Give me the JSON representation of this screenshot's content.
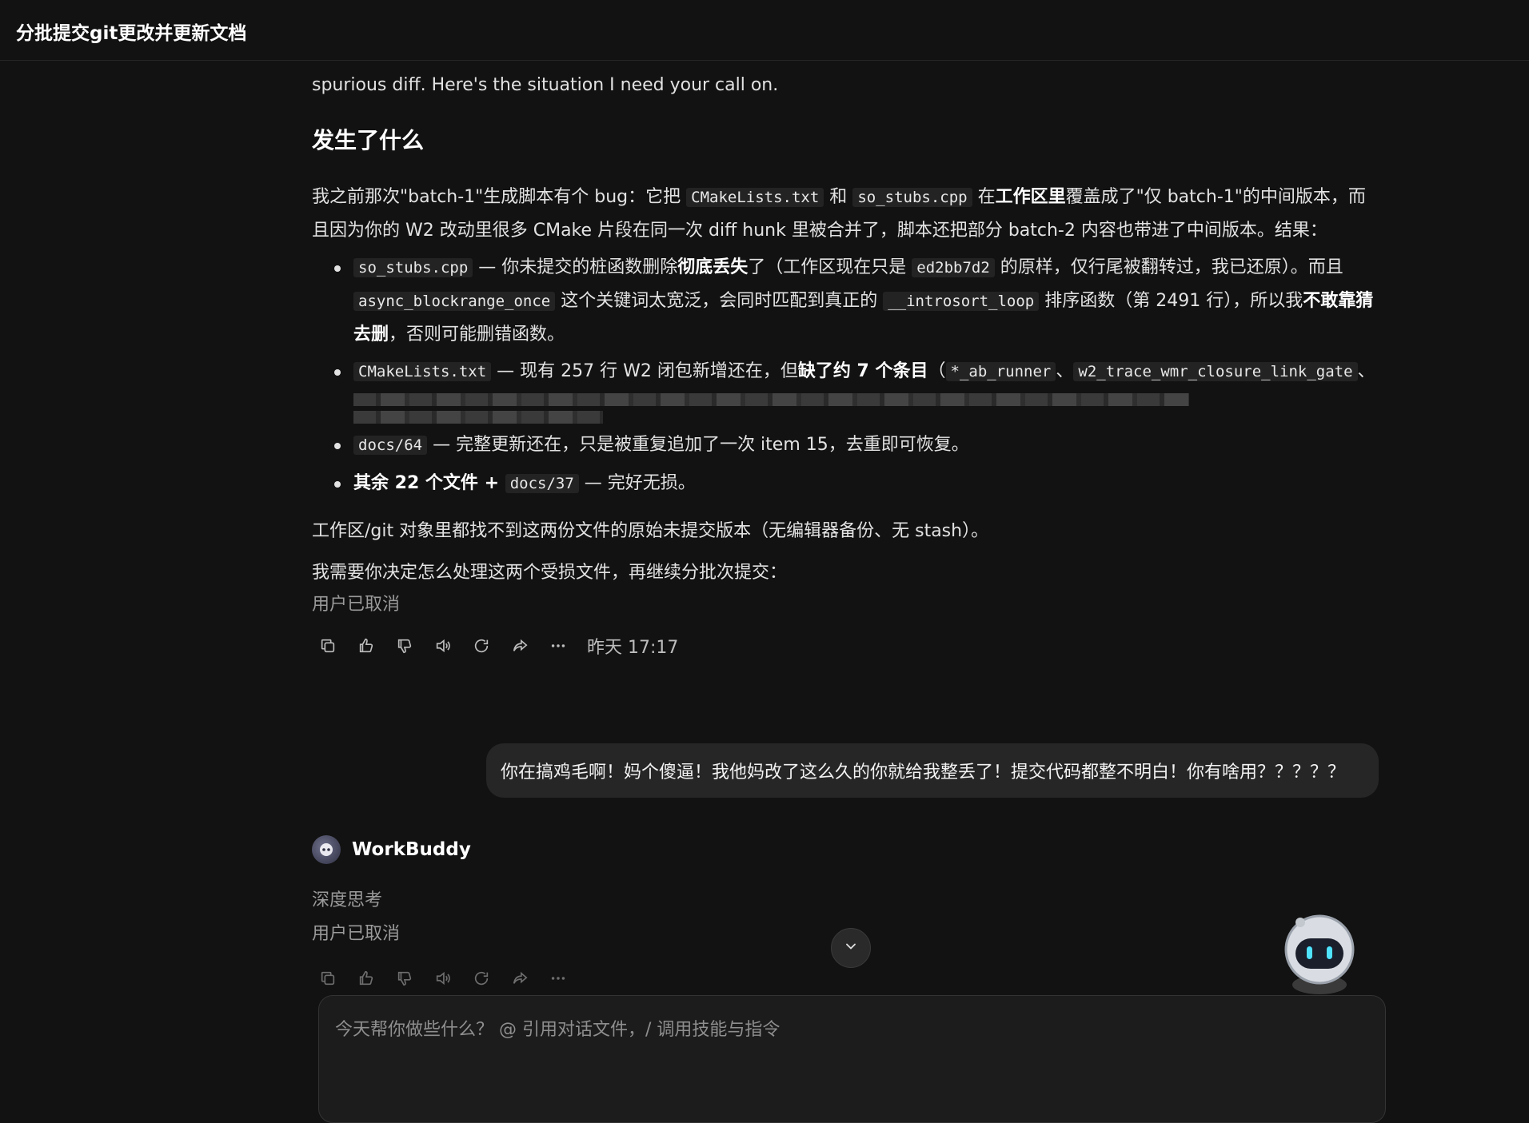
{
  "header": {
    "title": "分批提交git更改并更新文档"
  },
  "message1": {
    "intro_tail": "spurious diff. Here's the situation I need your call on.",
    "heading": "发生了什么",
    "p1": {
      "a": "我之前那次\"batch-1\"生成脚本有个 bug：它把 ",
      "code1": "CMakeLists.txt",
      "b": " 和 ",
      "code2": "so_stubs.cpp",
      "c": " 在",
      "bold1": "工作区里",
      "d": "覆盖成了\"仅 batch-1\"的中间版本，而且因为你的 W2 改动里很多 CMake 片段在同一次 diff hunk 里被合并了，脚本还把部分 batch-2 内容也带进了中间版本。结果："
    },
    "bullets": {
      "b1": {
        "code1": "so_stubs.cpp",
        "t1": " — 你未提交的桩函数删除",
        "bold1": "彻底丢失",
        "t2": "了（工作区现在只是 ",
        "code2": "ed2bb7d2",
        "t3": " 的原样，仅行尾被翻转过，我已还原）。而且 ",
        "code3": "async_blockrange_once",
        "t4": " 这个关键词太宽泛，会同时匹配到真正的 ",
        "code4": "__introsort_loop",
        "t5": " 排序函数（第 2491 行），所以我",
        "bold2": "不敢靠猜去删",
        "t6": "，否则可能删错函数。"
      },
      "b2": {
        "code1": "CMakeLists.txt",
        "t1": " — 现有 257 行 W2 闭包新增还在，但",
        "bold1": "缺了约 7 个条目",
        "t2": "（",
        "code2": "*_ab_runner",
        "t3": "、",
        "code3": "w2_trace_wmr_closure_link_gate",
        "t4": "、"
      },
      "b3": {
        "code1": "docs/64",
        "t1": " — 完整更新还在，只是被重复追加了一次 item 15，去重即可恢复。"
      },
      "b4": {
        "bold1": "其余 22 个文件 + ",
        "code1": "docs/37",
        "t1": " — 完好无损。"
      }
    },
    "p2": "工作区/git 对象里都找不到这两份文件的原始未提交版本（无编辑器备份、无 stash）。",
    "p3": "我需要你决定怎么处理这两个受损文件，再继续分批次提交：",
    "cancelled": "用户已取消",
    "timestamp": "昨天 17:17"
  },
  "user_message": "你在搞鸡毛啊！妈个傻逼！我他妈改了这么久的你就给我整丢了！提交代码都整不明白！你有啥用？？？？？",
  "reply": {
    "agent_name": "WorkBuddy",
    "thinking_label": "深度思考",
    "cancelled": "用户已取消"
  },
  "composer": {
    "placeholder": "今天帮你做些什么？ @ 引用对话文件，/ 调用技能与指令"
  },
  "icons": [
    "copy-icon",
    "thumbs-up-icon",
    "thumbs-down-icon",
    "speaker-icon",
    "regenerate-icon",
    "share-icon",
    "more-icon",
    "chevron-down-icon"
  ]
}
